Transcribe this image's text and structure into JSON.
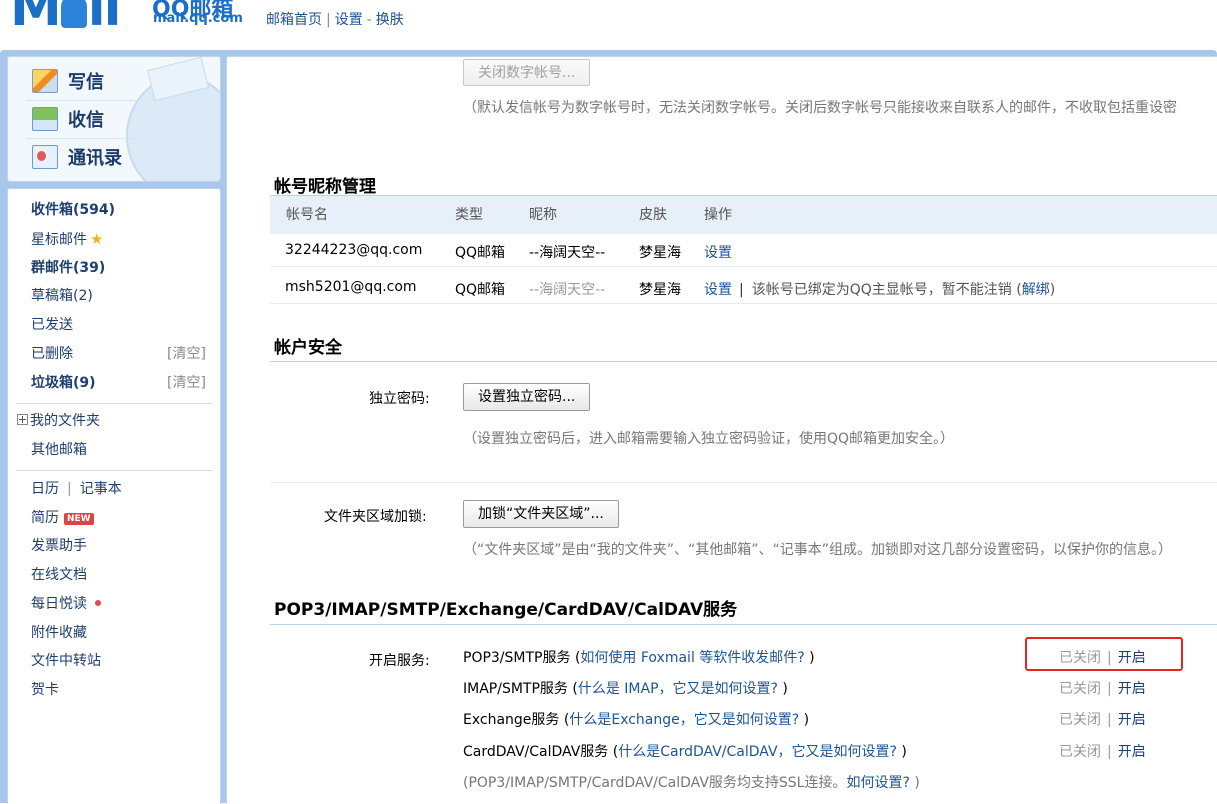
{
  "header": {
    "logo_text": "MO",
    "logo_brand": "QQ邮箱",
    "logo_url": "mail.qq.com",
    "user_line": "",
    "nav": [
      "邮箱首页",
      "设置",
      "换肤"
    ]
  },
  "compose": {
    "write": "写信",
    "receive": "收信",
    "contacts": "通讯录"
  },
  "folders": {
    "inbox": "收件箱(594)",
    "starred": "星标邮件",
    "group": "群邮件(39)",
    "drafts": "草稿箱(2)",
    "sent": "已发送",
    "deleted": "已删除",
    "spam": "垃圾箱(9)",
    "clear": "[清空]",
    "my_folders": "我的文件夹",
    "other_mailboxes": "其他邮箱",
    "calendar": "日历",
    "notebook": "记事本",
    "resume": "简历",
    "new_badge": "NEW",
    "invoice": "发票助手",
    "online_docs": "在线文档",
    "daily_reading": "每日悦读",
    "attachments": "附件收藏",
    "file_transfer": "文件中转站",
    "greeting_card": "贺卡"
  },
  "top_section": {
    "close_digit_btn": "关闭数字帐号...",
    "close_digit_note": "（默认发信帐号为数字帐号时，无法关闭数字帐号。关闭后数字帐号只能接收来自联系人的邮件，不收取包括重设密"
  },
  "nickname_mgmt": {
    "title": "帐号昵称管理",
    "headers": [
      "帐号名",
      "类型",
      "昵称",
      "皮肤",
      "操作"
    ],
    "rows": [
      {
        "account": "32244223@qq.com",
        "type": "QQ邮箱",
        "nickname": "--海阔天空--",
        "skin": "梦星海",
        "action": "设置"
      },
      {
        "account": "msh5201@qq.com",
        "type": "QQ邮箱",
        "nickname": "--海阔天空--",
        "skin": "梦星海",
        "action": "设置",
        "sep": "|",
        "note": "该帐号已绑定为QQ主显帐号，暂不能注销",
        "unbind": "解绑"
      }
    ]
  },
  "security": {
    "title": "帐户安全",
    "pwd_label": "独立密码:",
    "pwd_btn": "设置独立密码...",
    "pwd_note": "（设置独立密码后，进入邮箱需要输入独立密码验证，使用QQ邮箱更加安全。）",
    "lock_label": "文件夹区域加锁:",
    "lock_btn": "加锁“文件夹区域”...",
    "lock_note": "（“文件夹区域”是由“我的文件夹”、“其他邮箱”、“记事本”组成。加锁即对这几部分设置密码，以保护你的信息。）"
  },
  "services": {
    "title": "POP3/IMAP/SMTP/Exchange/CardDAV/CalDAV服务",
    "label": "开启服务:",
    "items": [
      {
        "name": "POP3/SMTP服务",
        "help": "如何使用 Foxmail 等软件收发邮件?",
        "status": "已关闭",
        "enable": "开启"
      },
      {
        "name": "IMAP/SMTP服务",
        "help": "什么是 IMAP，它又是如何设置?",
        "status": "已关闭",
        "enable": "开启"
      },
      {
        "name": "Exchange服务",
        "help": "什么是Exchange，它又是如何设置?",
        "status": "已关闭",
        "enable": "开启"
      },
      {
        "name": "CardDAV/CalDAV服务",
        "help": "什么是CardDAV/CalDAV，它又是如何设置?",
        "status": "已关闭",
        "enable": "开启"
      }
    ],
    "ssl_note": "(POP3/IMAP/SMTP/CardDAV/CalDAV服务均支持SSL连接。",
    "ssl_link": "如何设置?",
    "ssl_close": " )",
    "separator": "|"
  },
  "colors": {
    "accent": "#1e5494",
    "frame": "#a9c7ea",
    "highlight": "#e5261f"
  }
}
